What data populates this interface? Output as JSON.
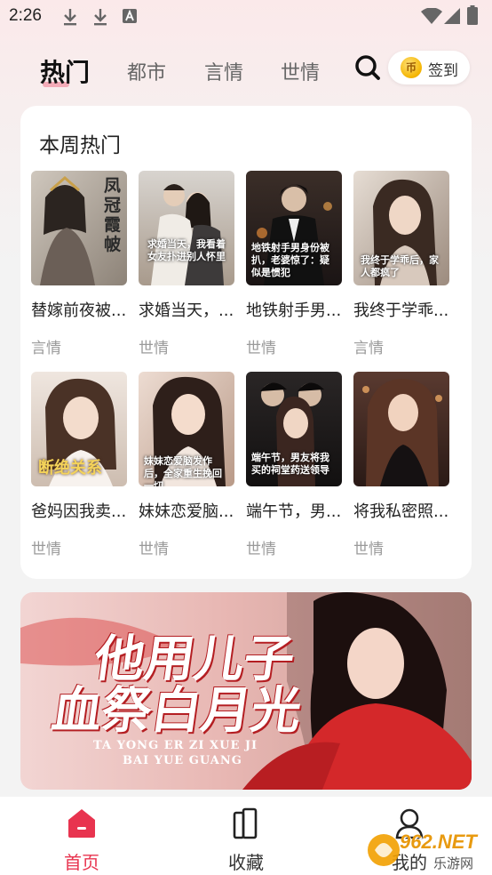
{
  "status_bar": {
    "time": "2:26"
  },
  "top_nav": {
    "tabs": [
      {
        "label": "热门",
        "active": true
      },
      {
        "label": "都市",
        "active": false
      },
      {
        "label": "言情",
        "active": false
      },
      {
        "label": "世情",
        "active": false
      }
    ],
    "signin_label": "签到",
    "coin_glyph": "币"
  },
  "hot_section": {
    "title": "本周热门",
    "books": [
      {
        "title": "替嫁前夜被...",
        "genre": "言情",
        "cover_text": "凤冠霞帔"
      },
      {
        "title": "求婚当天，...",
        "genre": "世情",
        "cover_text": "求婚当天，我看着女友扑进别人怀里"
      },
      {
        "title": "地铁射手男...",
        "genre": "世情",
        "cover_text": "地铁射手男身份被扒，老婆惊了：疑似是惯犯"
      },
      {
        "title": "我终于学乖...",
        "genre": "言情",
        "cover_text": "我终于学乖后，家人都疯了"
      },
      {
        "title": "爸妈因我卖...",
        "genre": "世情",
        "cover_text": "断绝关系"
      },
      {
        "title": "妹妹恋爱脑...",
        "genre": "世情",
        "cover_text": "妹妹恋爱脑发作后，全家重生挽回一切"
      },
      {
        "title": "端午节，男...",
        "genre": "世情",
        "cover_text": "端午节，男友将我买的祠堂药送领导"
      },
      {
        "title": "将我私密照...",
        "genre": "世情",
        "cover_text": ""
      }
    ]
  },
  "banner": {
    "title_line1": "他用儿子",
    "title_line2": "血祭白月光",
    "pinyin_line1": "TA YONG ER ZI XUE JI",
    "pinyin_line2": "BAI YUE GUANG"
  },
  "bottom_nav": {
    "items": [
      {
        "label": "首页",
        "icon": "home-icon",
        "active": true
      },
      {
        "label": "收藏",
        "icon": "bookshelf-icon",
        "active": false
      },
      {
        "label": "我的",
        "icon": "user-icon",
        "active": false
      }
    ]
  },
  "watermark": {
    "brand": "962.NET",
    "sub": "乐游网"
  },
  "colors": {
    "accent": "#e8344f",
    "page_bg": "#f3f3f3"
  }
}
